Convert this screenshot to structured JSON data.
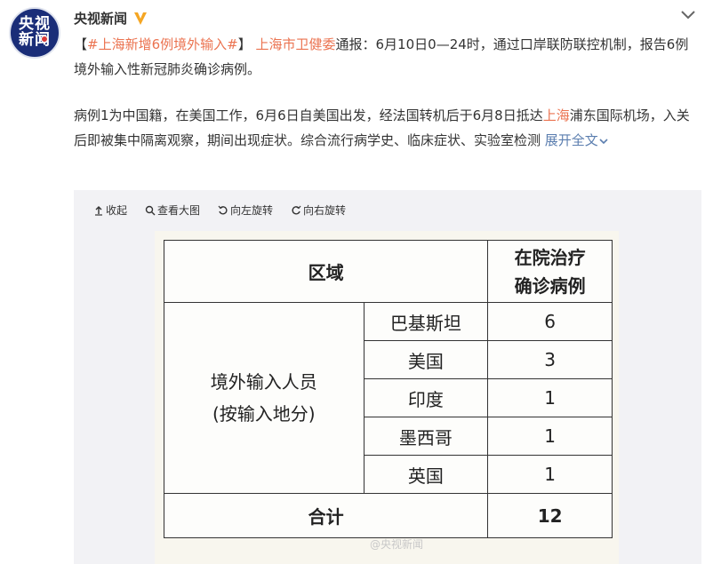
{
  "author": {
    "avatar_line1": "央视",
    "avatar_line2": "新闻",
    "name": "央视新闻"
  },
  "post": {
    "p1": {
      "bracket_open": "【",
      "hashtag": "#上海新增6例境外输入#",
      "bracket_close": "】",
      "mention": "上海市卫健委",
      "text": "通报：6月10日0—24时，通过口岸联防联控机制，报告6例境外输入性新冠肺炎确诊病例。"
    },
    "p2": {
      "text_a": "病例1为中国籍，在美国工作，6月6日自美国出发，经法国转机后于6月8日抵达",
      "place_link": "上海",
      "text_b": "浦东国际机场，入关后即被集中隔离观察，期间出现症状。综合流行病学史、临床症状、实验室检测",
      "expand": "展开全文"
    }
  },
  "toolbar": {
    "collapse": "收起",
    "view_large": "查看大图",
    "rotate_left": "向左旋转",
    "rotate_right": "向右旋转"
  },
  "table": {
    "header_region": "区域",
    "header_cases_line1": "在院治疗",
    "header_cases_line2": "确诊病例",
    "group_line1": "境外输入人员",
    "group_line2": "(按输入地分)",
    "rows": [
      {
        "country": "巴基斯坦",
        "count": "6"
      },
      {
        "country": "美国",
        "count": "3"
      },
      {
        "country": "印度",
        "count": "1"
      },
      {
        "country": "墨西哥",
        "count": "1"
      },
      {
        "country": "英国",
        "count": "1"
      }
    ],
    "total_label": "合计",
    "total_value": "12"
  },
  "watermark": "@央视新闻",
  "colors": {
    "link_orange": "#eb7350",
    "link_blue": "#5b7eaf",
    "verified_gold": "#f5a623",
    "avatar_bg": "#1a2d78"
  }
}
